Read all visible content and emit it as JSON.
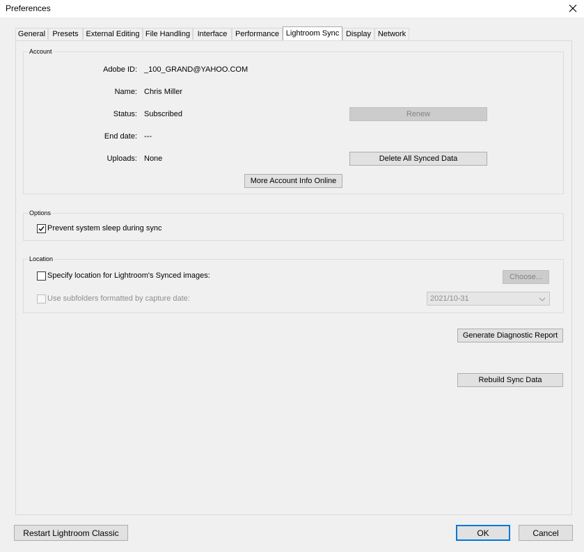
{
  "window": {
    "title": "Preferences",
    "close_glyph": "✕"
  },
  "tabs": [
    {
      "label": "General"
    },
    {
      "label": "Presets"
    },
    {
      "label": "External Editing"
    },
    {
      "label": "File Handling"
    },
    {
      "label": "Interface"
    },
    {
      "label": "Performance"
    },
    {
      "label": "Lightroom Sync",
      "active": true
    },
    {
      "label": "Display"
    },
    {
      "label": "Network"
    }
  ],
  "account": {
    "group_label": "Account",
    "adobe_id_label": "Adobe ID:",
    "adobe_id_value": "_100_GRAND@YAHOO.COM",
    "name_label": "Name:",
    "name_value": "Chris Miller",
    "status_label": "Status:",
    "status_value": "Subscribed",
    "end_date_label": "End date:",
    "end_date_value": "---",
    "uploads_label": "Uploads:",
    "uploads_value": "None",
    "renew_button": "Renew",
    "delete_button": "Delete All Synced Data",
    "more_info_button": "More Account Info Online"
  },
  "options": {
    "group_label": "Options",
    "prevent_sleep_label": "Prevent system sleep during sync",
    "prevent_sleep_checked": true
  },
  "location": {
    "group_label": "Location",
    "specify_label": "Specify location for Lightroom's Synced images:",
    "specify_checked": false,
    "choose_button": "Choose...",
    "subfolders_label": "Use subfolders formatted by capture date:",
    "subfolders_checked": false,
    "date_format_value": "2021/10-31"
  },
  "actions": {
    "diagnostic_button": "Generate Diagnostic Report",
    "rebuild_button": "Rebuild Sync Data"
  },
  "footer": {
    "restart_button": "Restart Lightroom Classic",
    "ok_button": "OK",
    "cancel_button": "Cancel"
  }
}
